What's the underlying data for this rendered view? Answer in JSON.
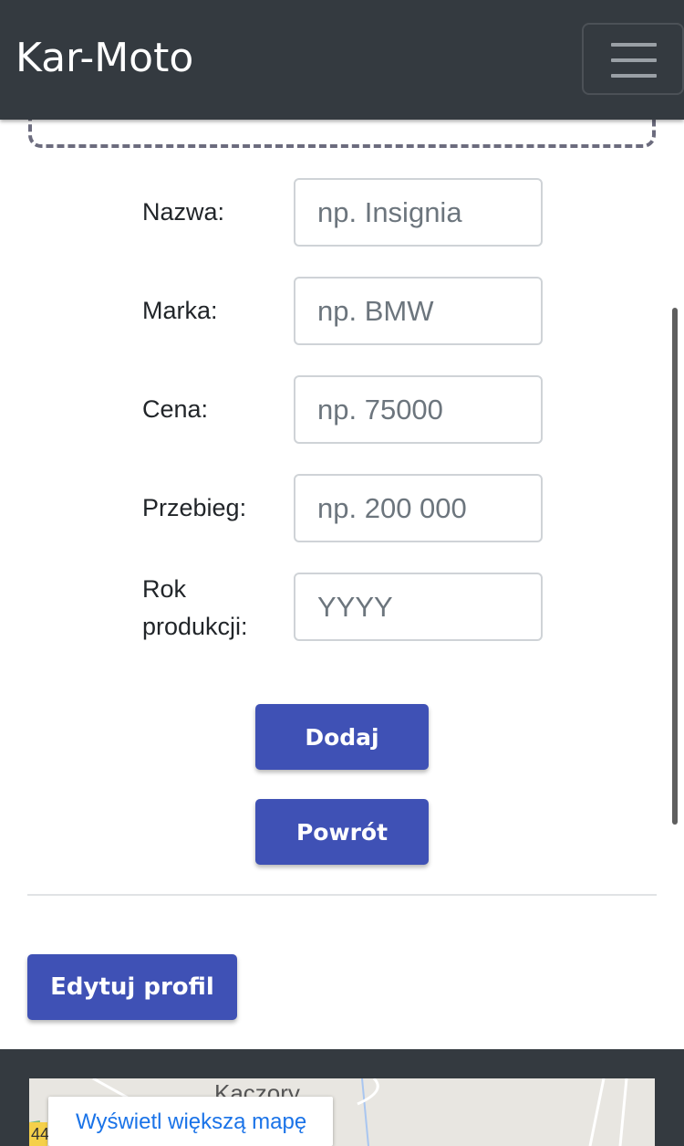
{
  "header": {
    "brand": "Kar-Moto",
    "menu_icon": "hamburger-icon"
  },
  "form": {
    "fields": [
      {
        "label": "Nazwa:",
        "placeholder": "np. Insignia"
      },
      {
        "label": "Marka:",
        "placeholder": "np. BMW"
      },
      {
        "label": "Cena:",
        "placeholder": "np. 75000"
      },
      {
        "label": "Przebieg:",
        "placeholder": "np. 200 000"
      },
      {
        "label_line1": "Rok",
        "label_line2": "produkcji:",
        "placeholder": "YYYY"
      }
    ],
    "add_label": "Dodaj",
    "back_label": "Powrót"
  },
  "profile": {
    "edit_label": "Edytuj profil"
  },
  "footer": {
    "map_place": "Kaczory",
    "map_road_badge": "44",
    "map_link": "Wyświetl większą mapę"
  },
  "colors": {
    "navbar": "#343a40",
    "primary": "#3f51b5",
    "link": "#1a73e8"
  }
}
